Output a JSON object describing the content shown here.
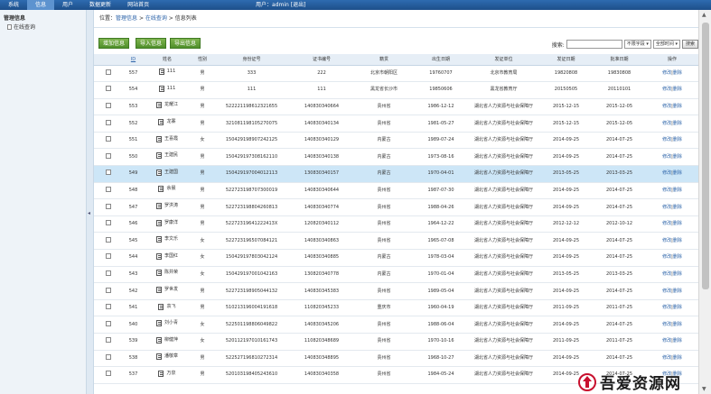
{
  "topbar": {
    "nav": [
      "系统",
      "信息",
      "用户",
      "数据更新",
      "网站首页"
    ],
    "active_index": 1,
    "user_label": "用户：",
    "username": "admin",
    "logout": "[退出]"
  },
  "sidebar": {
    "section": "管理信息",
    "item": "在线查询"
  },
  "breadcrumb": {
    "prefix": "位置：",
    "level1": "管理信息",
    "sep1": " > ",
    "level2": "在线查询",
    "sep2": " > ",
    "current": "信息列表"
  },
  "toolbar": {
    "add": "增加信息",
    "import": "导入信息",
    "export": "导出信息",
    "search_label": "搜索:",
    "search_value": "",
    "field_select": "不限字段",
    "time_select": "全部时间",
    "search_button": "搜索"
  },
  "table": {
    "headers": [
      "",
      "ID",
      "姓名",
      "性别",
      "身份证号",
      "证书编号",
      "籍贯",
      "出生日期",
      "发证单位",
      "发证日期",
      "批准日期",
      "操作"
    ],
    "edit": "修改",
    "sep": "|",
    "delete": "删除",
    "rows": [
      {
        "id": "557",
        "name": "111",
        "sex": "男",
        "idno": "333",
        "cert": "222",
        "place": "北京市朝阳区",
        "birth": "19760707",
        "unit": "北京市教育局",
        "issue": "19820808",
        "approve": "19830808"
      },
      {
        "id": "554",
        "name": "111",
        "sex": "男",
        "idno": "111",
        "cert": "111",
        "place": "黑龙省长沙市",
        "birth": "19850606",
        "unit": "黑龙省教育厅",
        "issue": "20150505",
        "approve": "20110101"
      },
      {
        "id": "553",
        "name": "龙耀江",
        "sex": "男",
        "idno": "522221198612321655",
        "cert": "140830340664",
        "place": "贵州省",
        "birth": "1986-12-12",
        "unit": "湖北省人力资源与社会保障厅",
        "issue": "2015-12-15",
        "approve": "2015-12-05"
      },
      {
        "id": "552",
        "name": "龙寨",
        "sex": "男",
        "idno": "321081198105270075",
        "cert": "140830340134",
        "place": "贵州省",
        "birth": "1981-05-27",
        "unit": "湖北省人力资源与社会保障厅",
        "issue": "2015-12-15",
        "approve": "2015-12-05"
      },
      {
        "id": "551",
        "name": "王喜霞",
        "sex": "女",
        "idno": "150429198907242125",
        "cert": "140830340129",
        "place": "内蒙古",
        "birth": "1989-07-24",
        "unit": "湖北省人力资源与社会保障厅",
        "issue": "2014-09-25",
        "approve": "2014-07-25"
      },
      {
        "id": "550",
        "name": "王建民",
        "sex": "男",
        "idno": "150429197308162110",
        "cert": "140830340138",
        "place": "内蒙古",
        "birth": "1973-08-16",
        "unit": "湖北省人力资源与社会保障厅",
        "issue": "2014-09-25",
        "approve": "2014-07-25"
      },
      {
        "id": "549",
        "name": "王建国",
        "sex": "男",
        "idno": "150429197004012113",
        "cert": "130830340157",
        "place": "内蒙古",
        "birth": "1970-04-01",
        "unit": "湖北省人力资源与社会保障厅",
        "issue": "2013-05-25",
        "approve": "2013-03-25"
      },
      {
        "id": "548",
        "name": "余晨",
        "sex": "男",
        "idno": "522723198707300019",
        "cert": "140830340644",
        "place": "贵州省",
        "birth": "1987-07-30",
        "unit": "湖北省人力资源与社会保障厅",
        "issue": "2014-09-25",
        "approve": "2014-07-25"
      },
      {
        "id": "547",
        "name": "罗洪涛",
        "sex": "男",
        "idno": "522723198804260813",
        "cert": "140830340774",
        "place": "贵州省",
        "birth": "1988-04-26",
        "unit": "湖北省人力资源与社会保障厅",
        "issue": "2014-09-25",
        "approve": "2014-07-25"
      },
      {
        "id": "546",
        "name": "罗康洋",
        "sex": "男",
        "idno": "52272319641222413X",
        "cert": "120820340112",
        "place": "贵州省",
        "birth": "1964-12-22",
        "unit": "湖北省人力资源与社会保障厅",
        "issue": "2012-12-12",
        "approve": "2012-10-12"
      },
      {
        "id": "545",
        "name": "李文乐",
        "sex": "女",
        "idno": "522723196507084121",
        "cert": "140830340863",
        "place": "贵州省",
        "birth": "1965-07-08",
        "unit": "湖北省人力资源与社会保障厅",
        "issue": "2014-09-25",
        "approve": "2014-07-25"
      },
      {
        "id": "544",
        "name": "李国红",
        "sex": "女",
        "idno": "150429197803042124",
        "cert": "140830340885",
        "place": "内蒙古",
        "birth": "1978-03-04",
        "unit": "湖北省人力资源与社会保障厅",
        "issue": "2014-09-25",
        "approve": "2014-07-25"
      },
      {
        "id": "543",
        "name": "陈井荣",
        "sex": "女",
        "idno": "150429197001042163",
        "cert": "130820340778",
        "place": "内蒙古",
        "birth": "1970-01-04",
        "unit": "湖北省人力资源与社会保障厅",
        "issue": "2013-05-25",
        "approve": "2013-03-25"
      },
      {
        "id": "542",
        "name": "罗世发",
        "sex": "男",
        "idno": "522723198905044132",
        "cert": "140830345383",
        "place": "贵州省",
        "birth": "1989-05-04",
        "unit": "湖北省人力资源与社会保障厅",
        "issue": "2014-09-25",
        "approve": "2014-07-25"
      },
      {
        "id": "541",
        "name": "袁飞",
        "sex": "男",
        "idno": "510213196004191618",
        "cert": "110820345233",
        "place": "重庆市",
        "birth": "1960-04-19",
        "unit": "湖北省人力资源与社会保障厅",
        "issue": "2011-09-25",
        "approve": "2011-07-25"
      },
      {
        "id": "540",
        "name": "刘小青",
        "sex": "女",
        "idno": "522501198806049822",
        "cert": "140830345206",
        "place": "贵州省",
        "birth": "1988-06-04",
        "unit": "湖北省人力资源与社会保障厅",
        "issue": "2014-09-25",
        "approve": "2014-07-25"
      },
      {
        "id": "539",
        "name": "柳健萍",
        "sex": "女",
        "idno": "520112197010161743",
        "cert": "110820348689",
        "place": "贵州省",
        "birth": "1970-10-16",
        "unit": "湖北省人力资源与社会保障厅",
        "issue": "2011-09-25",
        "approve": "2011-07-25"
      },
      {
        "id": "538",
        "name": "潘敬章",
        "sex": "男",
        "idno": "522527196810272314",
        "cert": "140830348895",
        "place": "贵州省",
        "birth": "1968-10-27",
        "unit": "湖北省人力资源与社会保障厅",
        "issue": "2014-09-25",
        "approve": "2014-07-25"
      },
      {
        "id": "537",
        "name": "万泉",
        "sex": "男",
        "idno": "520103198405243610",
        "cert": "140830340358",
        "place": "贵州省",
        "birth": "1984-05-24",
        "unit": "湖北省人力资源与社会保障厅",
        "issue": "2014-09-25",
        "approve": "2014-07-25"
      }
    ],
    "highlight_index": 6
  },
  "watermark": {
    "text": "吾爱资源网"
  }
}
